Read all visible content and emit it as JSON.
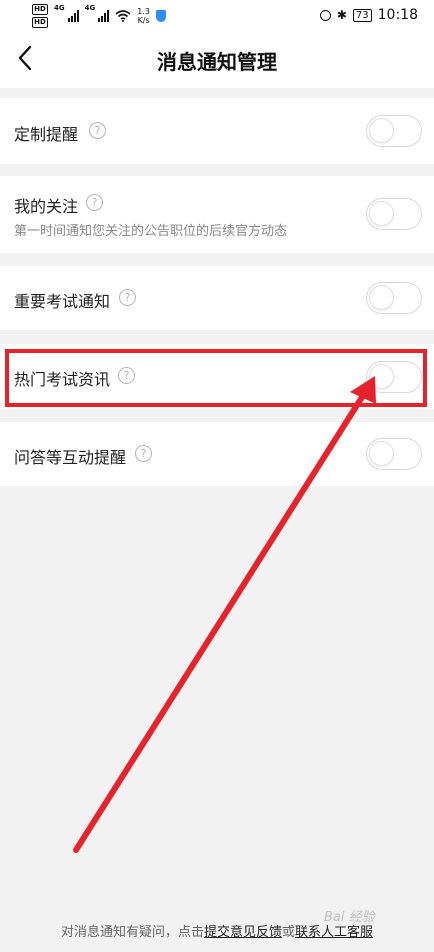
{
  "status_bar": {
    "net_speed_value": "1.3",
    "net_speed_unit": "K/s",
    "network_type": "4G",
    "hd_label": "HD",
    "battery": "73",
    "time": "10:18"
  },
  "header": {
    "title": "消息通知管理"
  },
  "settings": [
    {
      "label": "定制提醒",
      "subtitle": "",
      "enabled": false
    },
    {
      "label": "我的关注",
      "subtitle": "第一时间通知您关注的公告职位的后续官方动态",
      "enabled": false
    },
    {
      "label": "重要考试通知",
      "subtitle": "",
      "enabled": false
    },
    {
      "label": "热门考试资讯",
      "subtitle": "",
      "enabled": false
    },
    {
      "label": "问答等互动提醒",
      "subtitle": "",
      "enabled": false
    }
  ],
  "help_icon_glyph": "?",
  "footer": {
    "prefix": "对消息通知有疑问，点击",
    "feedback_link": "提交意见反馈",
    "middle": "或",
    "service_link": "联系人工客服"
  },
  "watermark": "Bai 经验",
  "colors": {
    "page_bg": "#f2f2f2",
    "card_bg": "#ffffff",
    "annotation_red": "#e5232c",
    "toggle_border": "#d9d9d9"
  }
}
